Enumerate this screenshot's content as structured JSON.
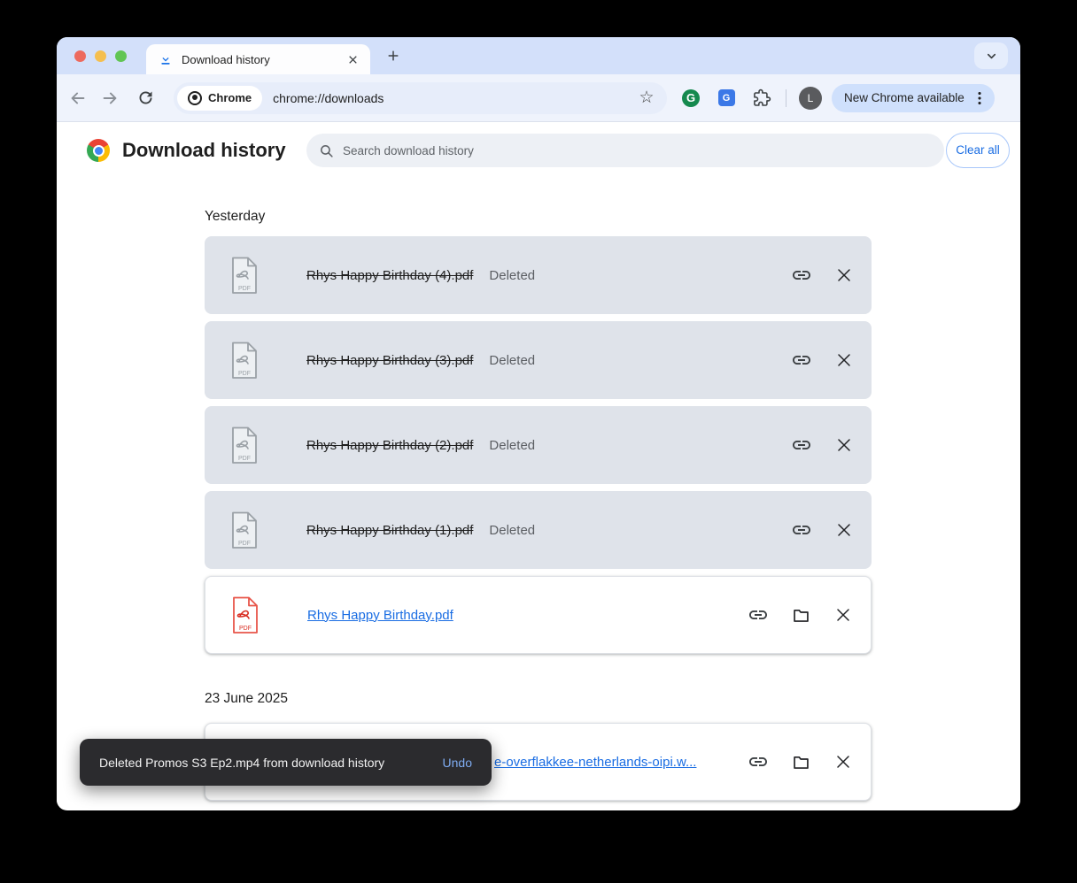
{
  "chrome": {
    "tab": {
      "title": "Download history"
    },
    "toolbar": {
      "site_chip_label": "Chrome",
      "url": "chrome://downloads",
      "update_button_label": "New Chrome available",
      "avatar_initial": "L"
    }
  },
  "page": {
    "title": "Download history",
    "search": {
      "placeholder": "Search download history"
    },
    "clear_all_label": "Clear all",
    "sections": [
      {
        "heading": "Yesterday",
        "items": [
          {
            "name": "Rhys Happy Birthday (4).pdf",
            "status": "Deleted",
            "state": "deleted",
            "file_badge": "PDF"
          },
          {
            "name": "Rhys Happy Birthday (3).pdf",
            "status": "Deleted",
            "state": "deleted",
            "file_badge": "PDF"
          },
          {
            "name": "Rhys Happy Birthday (2).pdf",
            "status": "Deleted",
            "state": "deleted",
            "file_badge": "PDF"
          },
          {
            "name": "Rhys Happy Birthday (1).pdf",
            "status": "Deleted",
            "state": "deleted",
            "file_badge": "PDF"
          },
          {
            "name": "Rhys Happy Birthday.pdf",
            "state": "active",
            "file_badge": "PDF"
          }
        ]
      },
      {
        "heading": "23 June 2025",
        "items": [
          {
            "name": "e-overflakkee-netherlands-oipi.w...",
            "state": "active"
          }
        ]
      }
    ]
  },
  "toast": {
    "message": "Deleted Promos S3 Ep2.mp4 from download history",
    "action_label": "Undo"
  },
  "colors": {
    "tab_strip_bg": "#D3E0FA",
    "toolbar_bg": "#EFF3FC",
    "deleted_row_bg": "#DFE3EA",
    "link_blue": "#1A6DE3",
    "toast_bg": "#2B2B2E",
    "toast_action_blue": "#7FACF2",
    "pdf_icon_red": "#E8564A",
    "pdf_icon_gray": "#9AA0A6"
  }
}
